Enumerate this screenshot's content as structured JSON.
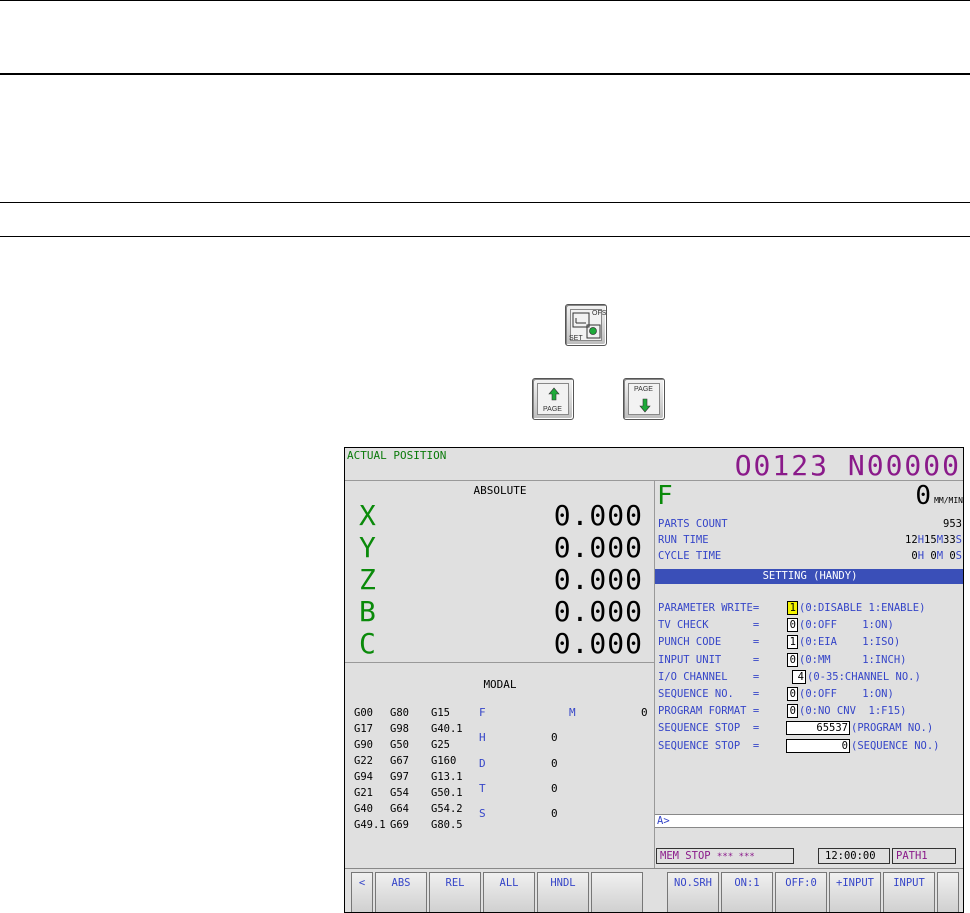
{
  "keys": {
    "offset_setting": {
      "top_label": "OFS",
      "bottom_label": "SET"
    },
    "page_up": {
      "label": "PAGE"
    },
    "page_down": {
      "label": "PAGE"
    }
  },
  "screen": {
    "title": "ACTUAL POSITION",
    "program_number": "O0123 N00000",
    "absolute": {
      "title": "ABSOLUTE",
      "axes": [
        {
          "name": "X",
          "value": "0.000"
        },
        {
          "name": "Y",
          "value": "0.000"
        },
        {
          "name": "Z",
          "value": "0.000"
        },
        {
          "name": "B",
          "value": "0.000"
        },
        {
          "name": "C",
          "value": "0.000"
        }
      ]
    },
    "modal": {
      "title": "MODAL",
      "gcodes": [
        [
          "G00",
          "G80",
          "G15"
        ],
        [
          "G17",
          "G98",
          "G40.1"
        ],
        [
          "G90",
          "G50",
          "G25"
        ],
        [
          "G22",
          "G67",
          "G160"
        ],
        [
          "G94",
          "G97",
          "G13.1"
        ],
        [
          "G21",
          "G54",
          "G50.1"
        ],
        [
          "G40",
          "G64",
          "G54.2"
        ],
        [
          "G49.1",
          "G69",
          "G80.5"
        ]
      ],
      "f_label": "F",
      "m_label": "M",
      "m_value": "0",
      "h_label": "H",
      "h_value": "0",
      "d_label": "D",
      "d_value": "0",
      "t_label": "T",
      "t_value": "0",
      "s_label": "S",
      "s_value": "0"
    },
    "feed": {
      "letter": "F",
      "value": "0",
      "unit": "MM/MIN"
    },
    "info": {
      "parts_count_label": "PARTS COUNT",
      "parts_count": "953",
      "run_time_label": "RUN TIME",
      "run_h": "12",
      "run_m": "15",
      "run_s": "33",
      "cycle_time_label": "CYCLE TIME",
      "cycle_h": "0",
      "cycle_m": "0",
      "cycle_s": "0",
      "h_unit": "H",
      "m_unit": "M",
      "s_unit": "S"
    },
    "setting": {
      "header": "SETTING (HANDY)",
      "rows": [
        {
          "name": "PARAMETER WRITE=",
          "value": "1",
          "desc": "(0:DISABLE 1:ENABLE)"
        },
        {
          "name": "TV CHECK       =",
          "value": "0",
          "desc": "(0:OFF    1:ON)"
        },
        {
          "name": "PUNCH CODE     =",
          "value": "1",
          "desc": "(0:EIA    1:ISO)"
        },
        {
          "name": "INPUT UNIT     =",
          "value": "0",
          "desc": "(0:MM     1:INCH)"
        },
        {
          "name": "I/O CHANNEL    =",
          "value": "4",
          "desc": "(0-35:CHANNEL NO.)"
        },
        {
          "name": "SEQUENCE NO.   =",
          "value": "0",
          "desc": "(0:OFF    1:ON)"
        },
        {
          "name": "PROGRAM FORMAT =",
          "value": "0",
          "desc": "(0:NO CNV  1:F15)"
        },
        {
          "name": "SEQUENCE STOP  =",
          "value": "65537",
          "desc": "(PROGRAM NO.)"
        },
        {
          "name": "SEQUENCE STOP  =",
          "value": "0",
          "desc": "(SEQUENCE NO.)"
        }
      ]
    },
    "input_prompt": "A>",
    "status": {
      "mode": "MEM",
      "state": "STOP",
      "alarm": "*** ***",
      "time": "12:00:00",
      "path": "PATH1"
    },
    "softkeys": {
      "left_arrow": "<",
      "abs": "ABS",
      "rel": "REL",
      "all": "ALL",
      "hndl": "HNDL",
      "blank": "",
      "no_srh": "NO.SRH",
      "on1": "ON:1",
      "off0": "OFF:0",
      "plus_input": "+INPUT",
      "input": "INPUT"
    },
    "colors": {
      "title_green": "#0a7a0a",
      "program_purple": "#8a1a8a",
      "label_blue": "#3545c8",
      "header_blue": "#3a4fb8",
      "highlight_yellow": "#f3f300"
    }
  }
}
